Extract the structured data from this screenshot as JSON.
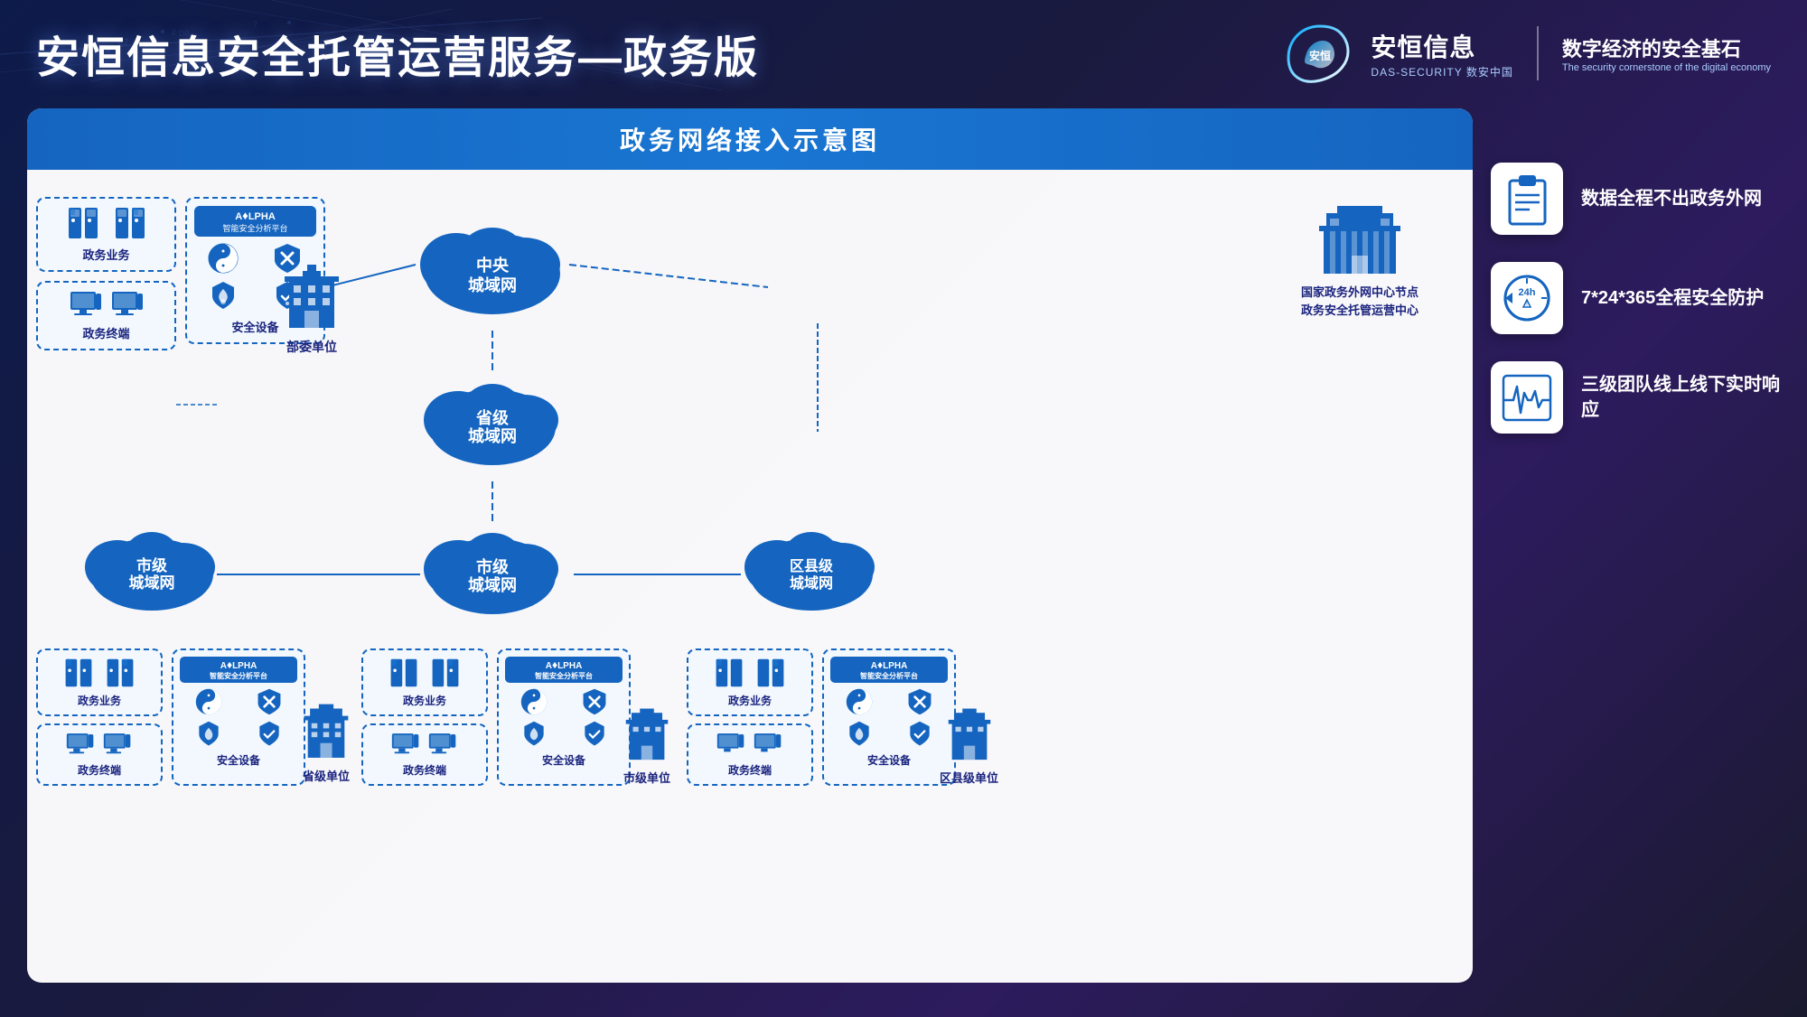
{
  "header": {
    "title": "安恒信息安全托管运营服务—政务版",
    "logo_brand": "安恒信息",
    "logo_sub": "DAS-SECURITY 数安中国",
    "logo_tagline_cn": "数字经济的安全基石",
    "logo_tagline_en": "The security cornerstone of the digital economy"
  },
  "diagram": {
    "title": "政务网络接入示意图",
    "nodes": {
      "central_cloud": "中央\n城域网",
      "province_cloud": "省级\n城域网",
      "city_center_cloud": "市级\n城域网",
      "city_left_cloud": "市级\n城域网",
      "district_cloud": "区县级\n城域网",
      "ministry_unit": "部委单位",
      "province_unit": "省级单位",
      "city_unit": "市级单位",
      "district_unit": "区县级单位",
      "national_center_line1": "国家政务外网中心节点",
      "national_center_line2": "政务安全托管运营中心",
      "gov_business_1": "政务业务",
      "gov_terminal_1": "政务终端",
      "security_device_1": "安全设备",
      "alpha_platform": "A＆LPHA\n智能安全分析平台",
      "gov_business_2": "政务业务",
      "gov_terminal_2": "政务终端",
      "security_device_2": "安全设备",
      "gov_business_3": "政务业务",
      "gov_terminal_3": "政务终端",
      "security_device_3": "安全设备"
    }
  },
  "features": [
    {
      "id": "data-no-leave",
      "icon": "clipboard",
      "text": "数据全程不出政务外网"
    },
    {
      "id": "24h-protection",
      "icon": "clock",
      "text": "7*24*365全程安全防护"
    },
    {
      "id": "three-tier",
      "icon": "heartbeat",
      "text": "三级团队线上线下实时响应"
    }
  ],
  "colors": {
    "primary_blue": "#1565c0",
    "dark_blue": "#1a237e",
    "bg_dark": "#0d1b4b",
    "white": "#ffffff",
    "cloud_blue": "#1976d2"
  }
}
